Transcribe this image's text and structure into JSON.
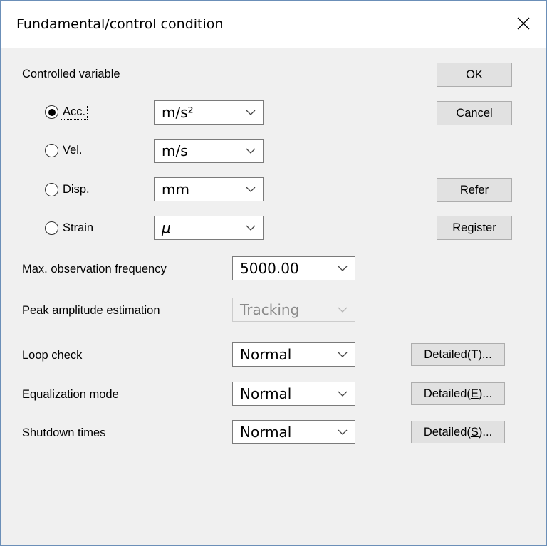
{
  "window": {
    "title": "Fundamental/control condition"
  },
  "controlled_variable": {
    "label": "Controlled variable",
    "options": [
      {
        "label": "Acc.",
        "selected": true,
        "unit": "m/s²"
      },
      {
        "label": "Vel.",
        "selected": false,
        "unit": "m/s"
      },
      {
        "label": "Disp.",
        "selected": false,
        "unit": "mm"
      },
      {
        "label": "Strain",
        "selected": false,
        "unit": "μ"
      }
    ]
  },
  "buttons": {
    "ok": "OK",
    "cancel": "Cancel",
    "refer": "Refer",
    "register": "Register"
  },
  "settings": [
    {
      "label": "Max. observation frequency",
      "value": "5000.00",
      "enabled": true,
      "detail": null
    },
    {
      "label": "Peak amplitude estimation",
      "value": "Tracking",
      "enabled": false,
      "detail": null
    },
    {
      "label": "Loop check",
      "value": "Normal",
      "enabled": true,
      "detail": {
        "prefix": "Detailed(",
        "key": "T",
        "suffix": ")..."
      }
    },
    {
      "label": "Equalization mode",
      "value": "Normal",
      "enabled": true,
      "detail": {
        "prefix": "Detailed(",
        "key": "E",
        "suffix": ")..."
      }
    },
    {
      "label": "Shutdown times",
      "value": "Normal",
      "enabled": true,
      "detail": {
        "prefix": "Detailed(",
        "key": "S",
        "suffix": ")..."
      }
    }
  ],
  "icons": {
    "close": "close-icon",
    "dropdown": "chevron-down-icon"
  }
}
